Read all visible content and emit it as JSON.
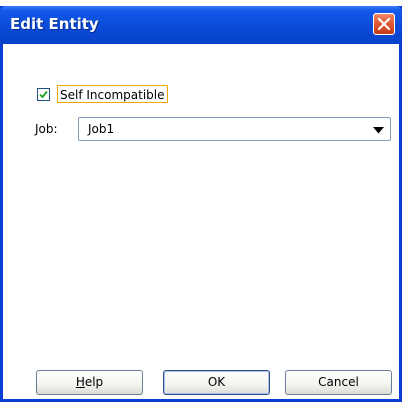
{
  "window": {
    "title": "Edit Entity"
  },
  "form": {
    "self_incompatible": {
      "label": "Self Incompatible",
      "checked": true
    },
    "job": {
      "label": "Job:",
      "value": "Job1"
    }
  },
  "buttons": {
    "help_first": "H",
    "help_rest": "elp",
    "ok": "OK",
    "cancel": "Cancel"
  },
  "icons": {
    "close": "close-icon",
    "check": "checkmark-icon",
    "dropdown": "chevron-down-icon"
  },
  "colors": {
    "title_bar": "#0a4ad8",
    "close_button": "#e0562e",
    "focus_outline": "#f0a800"
  }
}
